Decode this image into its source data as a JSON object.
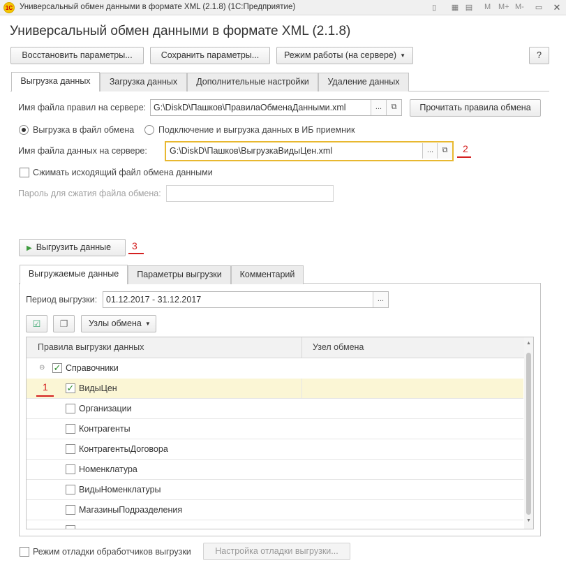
{
  "window": {
    "title": "Универсальный обмен данными в формате XML (2.1.8)  (1С:Предприятие)",
    "logo_text": "1С",
    "mem_labels": [
      "M",
      "M+",
      "M-"
    ],
    "close_glyph": "✕"
  },
  "form": {
    "title": "Универсальный обмен данными в формате XML (2.1.8)",
    "buttons": {
      "restore": "Восстановить параметры...",
      "save": "Сохранить параметры...",
      "mode": "Режим работы (на сервере)",
      "help": "?"
    }
  },
  "main_tabs": [
    "Выгрузка данных",
    "Загрузка данных",
    "Дополнительные настройки",
    "Удаление данных"
  ],
  "export": {
    "rules_file_label": "Имя файла правил на сервере:",
    "rules_file_value": "G:\\DiskD\\Пашков\\ПравилаОбменаДанными.xml",
    "read_rules_button": "Прочитать правила обмена",
    "radio_file": "Выгрузка в файл обмена",
    "radio_ib": "Подключение и выгрузка данных в ИБ приемник",
    "data_file_label": "Имя файла данных на сервере:",
    "data_file_value": "G:\\DiskD\\Пашков\\ВыгрузкаВидыЦен.xml",
    "compress_label": "Сжимать исходящий файл обмена данными",
    "password_label": "Пароль для сжатия файла обмена:",
    "password_value": "",
    "export_button": "Выгрузить данные",
    "ellipsis": "...",
    "open_glyph": "⧉"
  },
  "annotations": [
    "1",
    "2",
    "3"
  ],
  "inner_tabs": [
    "Выгружаемые данные",
    "Параметры выгрузки",
    "Комментарий"
  ],
  "period": {
    "label": "Период выгрузки:",
    "value": "01.12.2017 - 31.12.2017"
  },
  "nodes_button": "Узлы обмена",
  "table": {
    "columns": [
      "Правила выгрузки данных",
      "Узел обмена"
    ],
    "group": "Справочники",
    "rows": [
      {
        "name": "ВидыЦен",
        "checked": true,
        "selected": true
      },
      {
        "name": "Организации",
        "checked": false
      },
      {
        "name": "Контрагенты",
        "checked": false
      },
      {
        "name": "КонтрагентыДоговора",
        "checked": false
      },
      {
        "name": "Номенклатура",
        "checked": false
      },
      {
        "name": "ВидыНоменклатуры",
        "checked": false
      },
      {
        "name": "МагазиныПодразделения",
        "checked": false
      }
    ]
  },
  "footer": {
    "debug_label": "Режим отладки обработчиков выгрузки",
    "debug_settings_button": "Настройка отладки выгрузки..."
  },
  "colors": {
    "highlight_border": "#e8b830",
    "annotation": "#d42020",
    "selected_row": "#fbf6d5",
    "check_green": "#2a8a2a"
  }
}
